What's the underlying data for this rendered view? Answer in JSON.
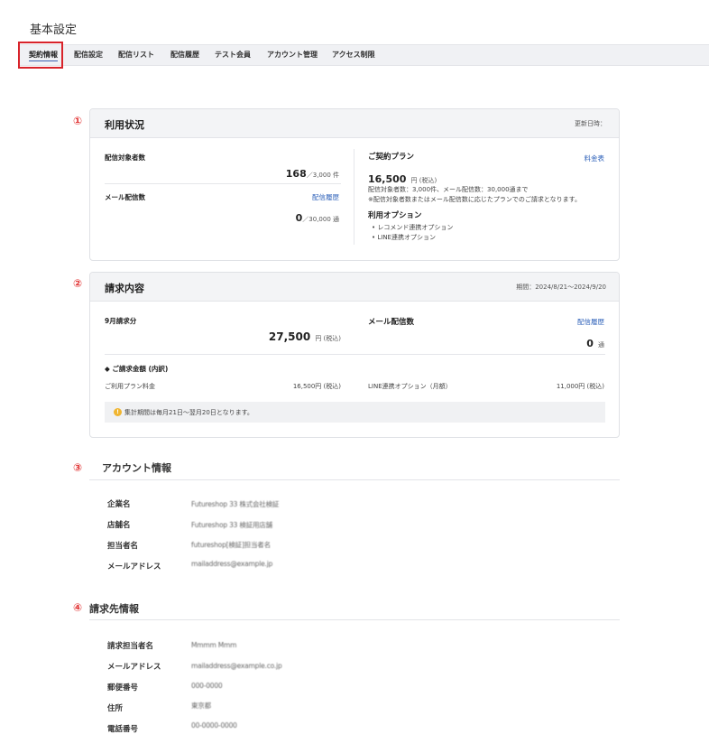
{
  "page": {
    "title": "基本設定"
  },
  "tabs": [
    {
      "label": "契約情報"
    },
    {
      "label": "配信設定"
    },
    {
      "label": "配信リスト"
    },
    {
      "label": "配信履歴"
    },
    {
      "label": "テスト会員"
    },
    {
      "label": "アカウント管理"
    },
    {
      "label": "アクセス制限"
    }
  ],
  "markers": [
    "①",
    "②",
    "③",
    "④"
  ],
  "usage": {
    "title": "利用状況",
    "updated_label": "更新日時：",
    "subscribers_label": "配信対象者数",
    "subscribers_value": "168",
    "subscribers_limit": "／3,000 件",
    "mail_label": "メール配信数",
    "mail_history_link": "配信履歴",
    "mail_value": "0",
    "mail_limit": "／30,000 通",
    "plan_label": "ご契約プラン",
    "price_table_link": "料金表",
    "plan_price": "16,500",
    "plan_price_unit": "円 (税込)",
    "plan_desc1": "配信対象者数：3,000件、メール配信数：30,000通まで",
    "plan_desc2": "※配信対象者数またはメール配信数に応じたプランでのご請求となります。",
    "options_label": "利用オプション",
    "options": [
      "レコメンド連携オプション",
      "LINE連携オプション"
    ]
  },
  "billing": {
    "title": "請求内容",
    "period": "期間：2024/8/21～2024/9/20",
    "month_label": "9月請求分",
    "amount": "27,500",
    "amount_unit": "円 (税込)",
    "mail_label": "メール配信数",
    "mail_history_link": "配信履歴",
    "mail_value": "0",
    "mail_unit": "通",
    "breakdown_label": "◆ ご請求金額 (内訳)",
    "plan_fee_label": "ご利用プラン料金",
    "plan_fee_value": "16,500円 (税込)",
    "line_option_label": "LINE連携オプション（月額）",
    "line_option_value": "11,000円 (税込)",
    "notice": "集計期間は毎月21日～翌月20日となります。"
  },
  "account": {
    "title": "アカウント情報",
    "rows": [
      {
        "label": "企業名",
        "value": "Futureshop 33 株式会社検証"
      },
      {
        "label": "店舗名",
        "value": "Futureshop 33 検証用店舗"
      },
      {
        "label": "担当者名",
        "value": "futureshop[検証]担当者名"
      },
      {
        "label": "メールアドレス",
        "value": "mailaddress@example.jp"
      }
    ]
  },
  "billing_contact": {
    "title": "請求先情報",
    "rows": [
      {
        "label": "請求担当者名",
        "value": "Mmmm Mmm"
      },
      {
        "label": "メールアドレス",
        "value": "mailaddress@example.co.jp"
      },
      {
        "label": "郵便番号",
        "value": "000-0000"
      },
      {
        "label": "住所",
        "value": "東京都"
      },
      {
        "label": "電話番号",
        "value": "00-0000-0000"
      }
    ]
  }
}
